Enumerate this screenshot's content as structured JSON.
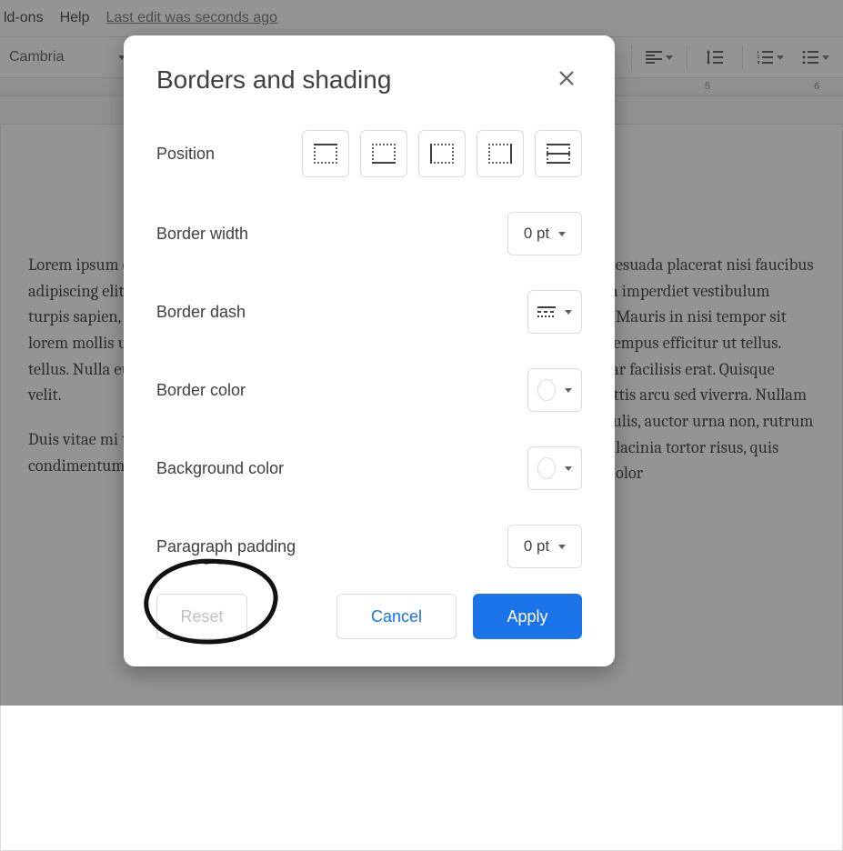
{
  "menubar": {
    "items": [
      "ld-ons",
      "Help"
    ],
    "last_edit": "Last edit was seconds ago"
  },
  "toolbar": {
    "font": "Cambria"
  },
  "ruler": {
    "marks": [
      "5",
      "6"
    ]
  },
  "document": {
    "col1_p1": "Lorem ipsum dolor sit amet, consectetur adipiscing elit et mauris. Suspendisse turpis sapien, malesuada et accumsan lorem mollis urna e in. Maecenas orci ex, tellus. Nulla eu tellus. Donec eu est. Sed id velit.",
    "col1_p2": "Duis vitae mi tempor congue condimentum id dui.",
    "col2_p1": "Praesent malesuada placerat nisi faucibus laoreet. Nulla imperdiet vestibulum ullamcorper. Mauris in nisi tempor sit elementum tempus efficitur ut tellus. Nunc pulvinar facilisis erat. Quisque volutpat sagittis arcu sed viverra. Nullam eu ipsum iaculis, auctor urna non, rutrum neque. Proin lacinia tortor risus, quis vestibulum dolor"
  },
  "dialog": {
    "title": "Borders and shading",
    "rows": {
      "position": "Position",
      "border_width": "Border width",
      "border_dash": "Border dash",
      "border_color": "Border color",
      "background_color": "Background color",
      "paragraph_padding": "Paragraph padding"
    },
    "values": {
      "border_width": "0 pt",
      "paragraph_padding": "0 pt"
    },
    "buttons": {
      "reset": "Reset",
      "cancel": "Cancel",
      "apply": "Apply"
    }
  }
}
